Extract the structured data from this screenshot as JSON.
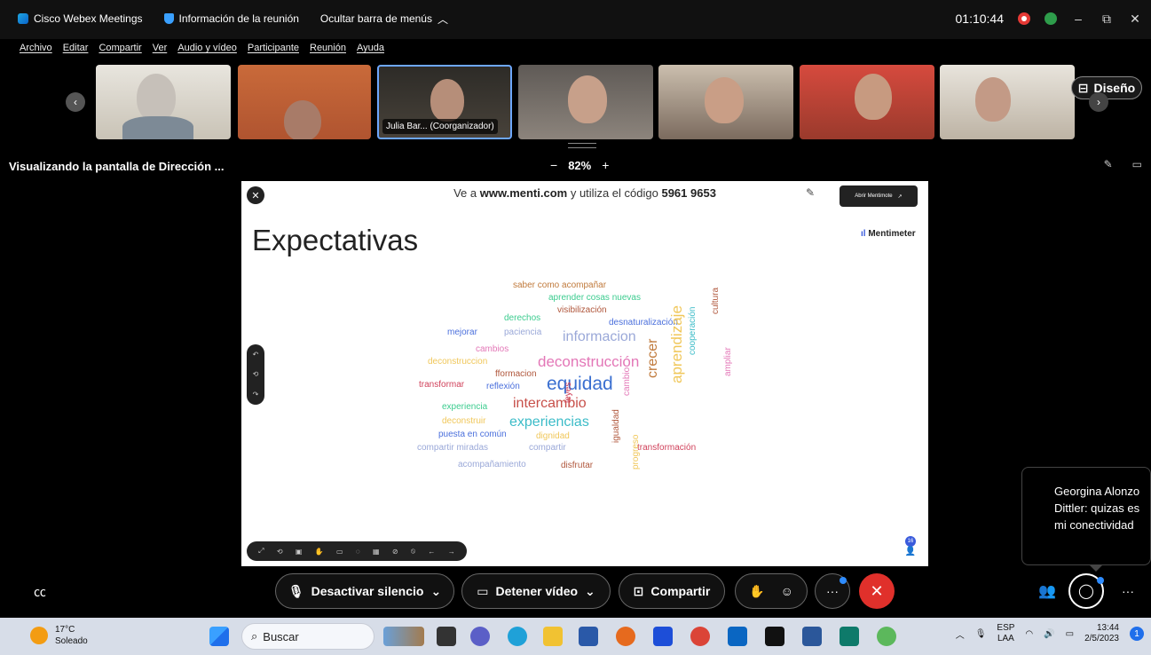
{
  "titlebar": {
    "app_name": "Cisco Webex Meetings",
    "meeting_info": "Información de la reunión",
    "hide_menu": "Ocultar barra de menús",
    "timer": "01:10:44"
  },
  "menu": [
    "Archivo",
    "Editar",
    "Compartir",
    "Ver",
    "Audio y vídeo",
    "Participante",
    "Reunión",
    "Ayuda"
  ],
  "participants": {
    "active_label": "Julia Bar... (Coorganizador)",
    "layout_button": "Diseño"
  },
  "share": {
    "title": "Visualizando la pantalla de Dirección ...",
    "zoom": "82%",
    "zoom_minus": "−",
    "zoom_plus": "+"
  },
  "slide": {
    "instruction_prefix": "Ve a",
    "instruction_url": "www.menti.com",
    "instruction_middle": "y utiliza el código",
    "code": "5961 9653",
    "open_button": "Abrir Mentimote",
    "brand": "Mentimeter",
    "title": "Expectativas",
    "participant_count": "16",
    "words": [
      {
        "text": "saber como acompañar",
        "color": "#c07a3c",
        "size": 10
      },
      {
        "text": "aprender cosas nuevas",
        "color": "#3ccc8f",
        "size": 10
      },
      {
        "text": "visibilización",
        "color": "#b0573c",
        "size": 10
      },
      {
        "text": "derechos",
        "color": "#3ccc8f",
        "size": 10
      },
      {
        "text": "desnaturalización",
        "color": "#4a6fdc",
        "size": 10
      },
      {
        "text": "mejorar",
        "color": "#4a6fdc",
        "size": 10
      },
      {
        "text": "paciencia",
        "color": "#9aa8d8",
        "size": 10
      },
      {
        "text": "informacion",
        "color": "#9aa8d8",
        "size": 16
      },
      {
        "text": "cambios",
        "color": "#e377b7",
        "size": 10
      },
      {
        "text": "deconstruccion",
        "color": "#f0c75a",
        "size": 10
      },
      {
        "text": "deconstrucción",
        "color": "#e377b7",
        "size": 17
      },
      {
        "text": "fformacion",
        "color": "#b0573c",
        "size": 10
      },
      {
        "text": "transformar",
        "color": "#d0405a",
        "size": 10
      },
      {
        "text": "reflexión",
        "color": "#4a6fdc",
        "size": 10
      },
      {
        "text": "equidad",
        "color": "#3a6fd0",
        "size": 21
      },
      {
        "text": "intercambio",
        "color": "#c7504a",
        "size": 16
      },
      {
        "text": "experiencia",
        "color": "#3ccc8f",
        "size": 10
      },
      {
        "text": "experiencias",
        "color": "#3cbcc8",
        "size": 16
      },
      {
        "text": "deconstruir",
        "color": "#f0c75a",
        "size": 10
      },
      {
        "text": "puesta en común",
        "color": "#4a6fdc",
        "size": 10
      },
      {
        "text": "dignidad",
        "color": "#f0c75a",
        "size": 10
      },
      {
        "text": "compartir miradas",
        "color": "#9aa8d8",
        "size": 10
      },
      {
        "text": "compartir",
        "color": "#9aa8d8",
        "size": 10
      },
      {
        "text": "transformación",
        "color": "#d0405a",
        "size": 10
      },
      {
        "text": "acompañamiento",
        "color": "#9aa8d8",
        "size": 10
      },
      {
        "text": "disfrutar",
        "color": "#b0573c",
        "size": 10
      },
      {
        "text": "crecer",
        "color": "#c07a3c",
        "size": 16
      },
      {
        "text": "aprendizaje",
        "color": "#f0c75a",
        "size": 17
      },
      {
        "text": "cooperación",
        "color": "#3cbcc8",
        "size": 10
      },
      {
        "text": "cultura",
        "color": "#b0573c",
        "size": 10
      },
      {
        "text": "ampliar",
        "color": "#e377b7",
        "size": 10
      },
      {
        "text": "cambio",
        "color": "#e377b7",
        "size": 10
      },
      {
        "text": "leyes",
        "color": "#d0405a",
        "size": 10
      },
      {
        "text": "igualdad",
        "color": "#b0573c",
        "size": 10
      },
      {
        "text": "progreso",
        "color": "#f0c75a",
        "size": 10
      }
    ]
  },
  "toast": {
    "message": "Georgina Alonzo Dittler: quizas es mi conectividad"
  },
  "controls": {
    "mute": "Desactivar silencio",
    "video": "Detener vídeo",
    "share": "Compartir",
    "more": "···"
  },
  "taskbar": {
    "weather_temp": "17°C",
    "weather_desc": "Soleado",
    "search_placeholder": "Buscar",
    "lang_top": "ESP",
    "lang_bottom": "LAA",
    "time": "13:44",
    "date": "2/5/2023",
    "notifications": "1"
  }
}
